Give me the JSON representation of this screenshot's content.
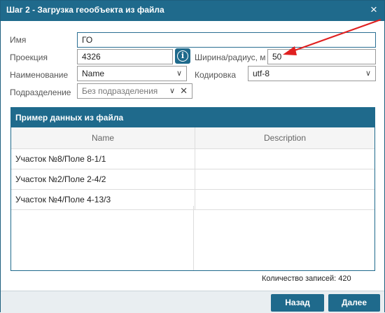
{
  "dialog": {
    "title": "Шаг 2 - Загрузка геообъекта из файла",
    "close_icon": "×"
  },
  "form": {
    "name": {
      "label": "Имя",
      "value": "ГО"
    },
    "projection": {
      "label": "Проекция",
      "value": "4326"
    },
    "width": {
      "label": "Ширина/радиус, м",
      "value": "50"
    },
    "naming": {
      "label": "Наименование",
      "value": "Name"
    },
    "encoding": {
      "label": "Кодировка",
      "value": "utf-8"
    },
    "subdivision": {
      "label": "Подразделение",
      "value": "Без подразделения"
    }
  },
  "sample": {
    "title": "Пример данных из файла",
    "columns": [
      "Name",
      "Description"
    ],
    "rows": [
      [
        "Участок №8/Поле 8-1/1",
        ""
      ],
      [
        "Участок №2/Поле 2-4/2",
        ""
      ],
      [
        "Участок №4/Поле 4-13/3",
        ""
      ]
    ]
  },
  "records": {
    "label": "Количество записей: 420"
  },
  "buttons": {
    "back": "Назад",
    "next": "Далее"
  },
  "colors": {
    "accent": "#1f6a8c",
    "annotation_arrow": "#e02020"
  },
  "icons": {
    "info": "info-icon",
    "close": "close-icon",
    "dropdown": "chevron-down-icon",
    "clear": "clear-icon"
  }
}
